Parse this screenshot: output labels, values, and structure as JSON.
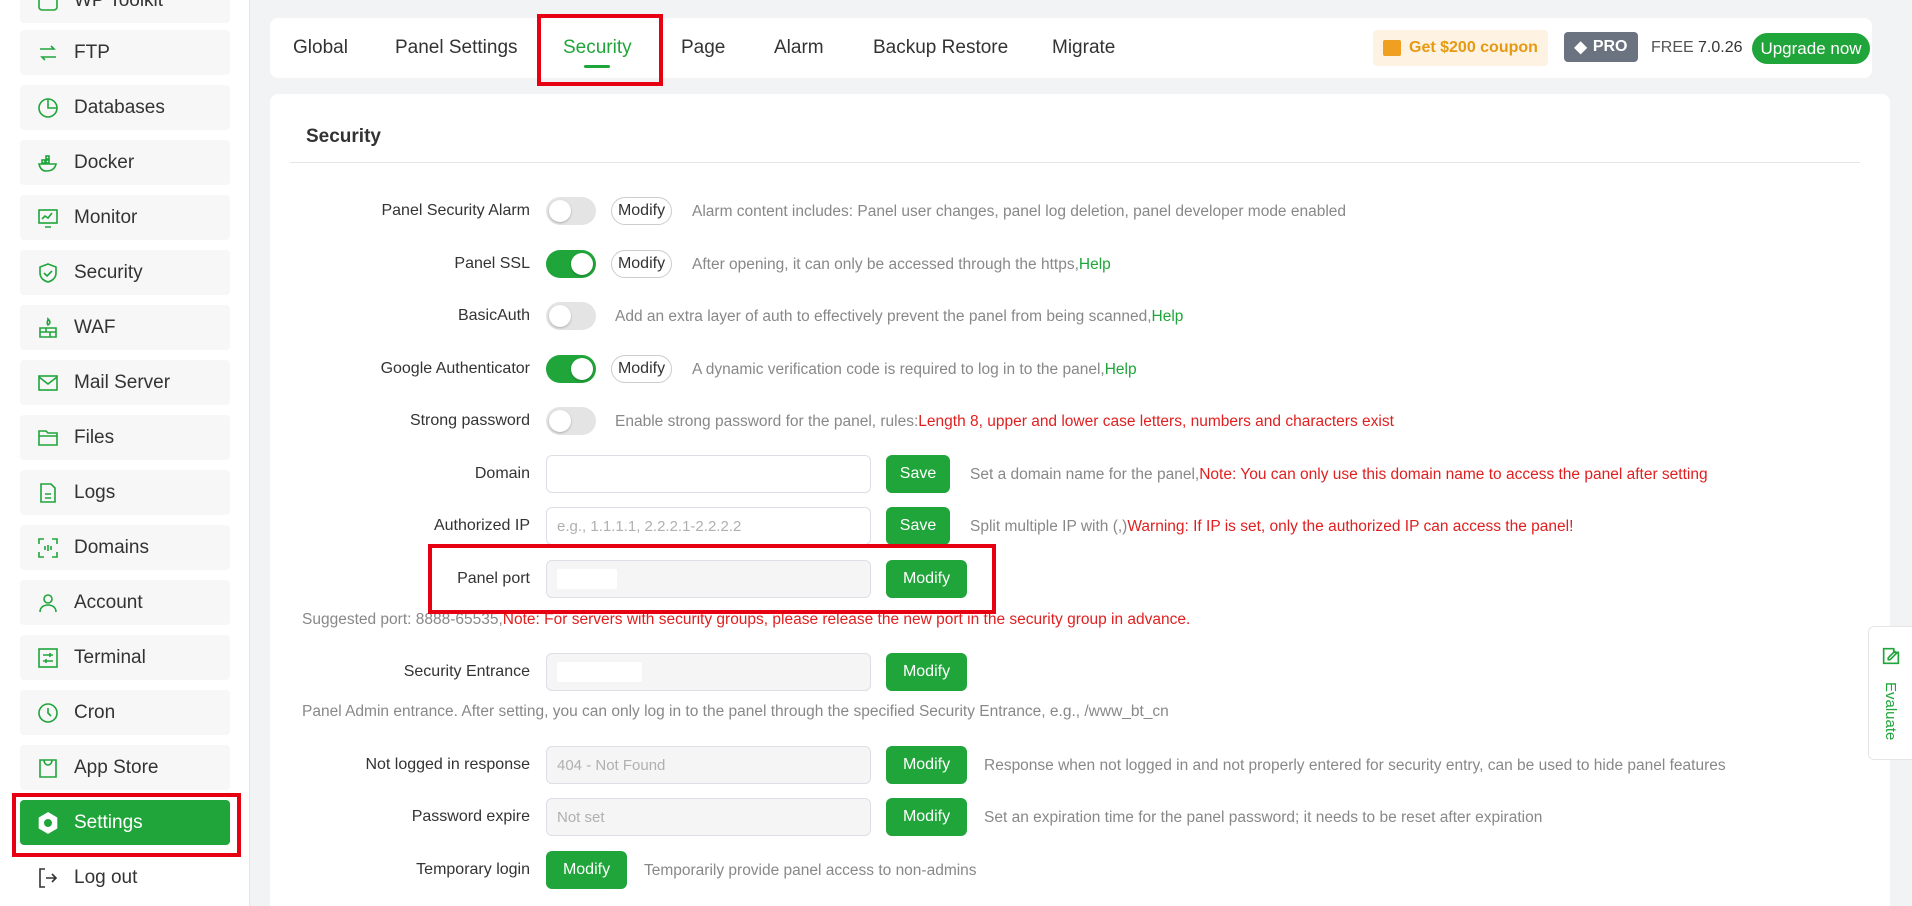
{
  "sidebar": {
    "items": [
      {
        "label": "WP Toolkit",
        "icon": "wordpress-icon"
      },
      {
        "label": "FTP",
        "icon": "ftp-icon"
      },
      {
        "label": "Databases",
        "icon": "database-icon"
      },
      {
        "label": "Docker",
        "icon": "docker-icon"
      },
      {
        "label": "Monitor",
        "icon": "monitor-icon"
      },
      {
        "label": "Security",
        "icon": "shield-icon"
      },
      {
        "label": "WAF",
        "icon": "firewall-icon"
      },
      {
        "label": "Mail Server",
        "icon": "mail-icon"
      },
      {
        "label": "Files",
        "icon": "folder-icon"
      },
      {
        "label": "Logs",
        "icon": "log-icon"
      },
      {
        "label": "Domains",
        "icon": "domain-icon"
      },
      {
        "label": "Account",
        "icon": "user-icon"
      },
      {
        "label": "Terminal",
        "icon": "terminal-icon"
      },
      {
        "label": "Cron",
        "icon": "clock-icon"
      },
      {
        "label": "App Store",
        "icon": "store-icon"
      },
      {
        "label": "Settings",
        "icon": "gear-icon"
      },
      {
        "label": "Log out",
        "icon": "logout-icon"
      }
    ]
  },
  "tabs": [
    {
      "label": "Global"
    },
    {
      "label": "Panel Settings"
    },
    {
      "label": "Security"
    },
    {
      "label": "Page"
    },
    {
      "label": "Alarm"
    },
    {
      "label": "Backup Restore"
    },
    {
      "label": "Migrate"
    }
  ],
  "header": {
    "coupon": "Get $200 coupon",
    "pro": "PRO",
    "free": "FREE",
    "version": "7.0.26",
    "upgrade": "Upgrade now"
  },
  "colors": {
    "accent": "#20a53a",
    "warning": "#e02020",
    "highlight": "#e60012"
  },
  "security": {
    "title": "Security",
    "alarm": {
      "label": "Panel Security Alarm",
      "modify": "Modify",
      "desc": "Alarm content includes: Panel user changes, panel log deletion, panel developer mode enabled"
    },
    "ssl": {
      "label": "Panel SSL",
      "modify": "Modify",
      "desc": "After opening, it can only be accessed through the https,",
      "help": "Help"
    },
    "basicauth": {
      "label": "BasicAuth",
      "desc": "Add an extra layer of auth to effectively prevent the panel from being scanned,",
      "help": "Help"
    },
    "gauth": {
      "label": "Google Authenticator",
      "modify": "Modify",
      "desc": "A dynamic verification code is required to log in to the panel,",
      "help": "Help"
    },
    "strongpw": {
      "label": "Strong password",
      "desc": "Enable strong password for the panel, rules:",
      "rule": "Length 8, upper and lower case letters, numbers and characters exist"
    },
    "domain": {
      "label": "Domain",
      "value": "",
      "save": "Save",
      "desc": "Set a domain name for the panel,",
      "note": "Note: You can only use this domain name to access the panel after setting"
    },
    "authip": {
      "label": "Authorized IP",
      "placeholder": "e.g., 1.1.1.1, 2.2.2.1-2.2.2.2",
      "save": "Save",
      "desc": "Split multiple IP with (,)",
      "warning": "Warning: If IP is set, only the authorized IP can access the panel!"
    },
    "port": {
      "label": "Panel port",
      "modify": "Modify",
      "suggest": "Suggested port: 8888-65535,",
      "note": "Note: For servers with security groups, please release the new port in the security group in advance."
    },
    "entrance": {
      "label": "Security Entrance",
      "modify": "Modify",
      "desc": "Panel Admin entrance. After setting, you can only log in to the panel through the specified Security Entrance, e.g., /www_bt_cn"
    },
    "notlogged": {
      "label": "Not logged in response",
      "value": "404 - Not Found",
      "modify": "Modify",
      "desc": "Response when not logged in and not properly entered for security entry, can be used to hide panel features"
    },
    "pwexpire": {
      "label": "Password expire",
      "value": "Not set",
      "modify": "Modify",
      "desc": "Set an expiration time for the panel password; it needs to be reset after expiration"
    },
    "templogin": {
      "label": "Temporary login",
      "modify": "Modify",
      "desc": "Temporarily provide panel access to non-admins"
    }
  },
  "evaluate": {
    "label": "Evaluate"
  }
}
